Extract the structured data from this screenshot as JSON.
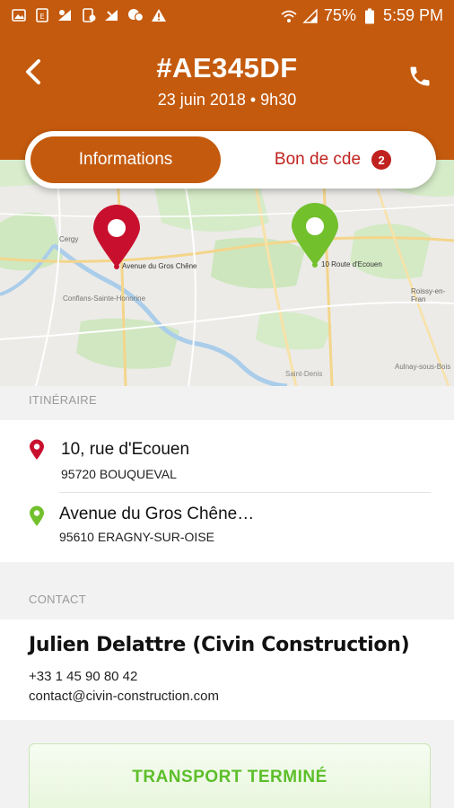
{
  "status_bar": {
    "battery": "75%",
    "time": "5:59 PM"
  },
  "header": {
    "title": "#AE345DF",
    "subtitle": "23 juin 2018 • 9h30",
    "icons": {
      "back": "back-arrow-icon",
      "call": "phone-icon"
    },
    "color": "#c45a0d"
  },
  "tabs": {
    "active": "Informations",
    "second": "Bon de cde",
    "badge_count": "2"
  },
  "map": {
    "labels": {
      "origin": "Avenue du Gros Chêne",
      "destination": "10 Route d'Ecouen",
      "town1": "Cergy",
      "town2": "Saint-Denis",
      "town3": "Roissy-en-Fran",
      "town4": "Aulnay-sous-Bois",
      "town5": "Conflans-Sainte-Honorine"
    },
    "pin_colors": {
      "origin": "#c8102e",
      "destination": "#72c02c"
    }
  },
  "itinerary": {
    "section_label": "ITINÉRAIRE",
    "stops": [
      {
        "line1": "10, rue d'Ecouen",
        "line2": "95720 BOUQUEVAL",
        "pin_color": "#c8102e"
      },
      {
        "line1": "Avenue du Gros Chêne…",
        "line2": "95610 ERAGNY-SUR-OISE",
        "pin_color": "#72c02c"
      }
    ]
  },
  "contact": {
    "section_label": "CONTACT",
    "name": "Julien Delattre (Civin Construction)",
    "phone": "+33 1 45 90 80 42",
    "email": "contact@civin-construction.com"
  },
  "actions": {
    "done_label": "TRANSPORT TERMINÉ",
    "done_color": "#5cbf2a"
  }
}
